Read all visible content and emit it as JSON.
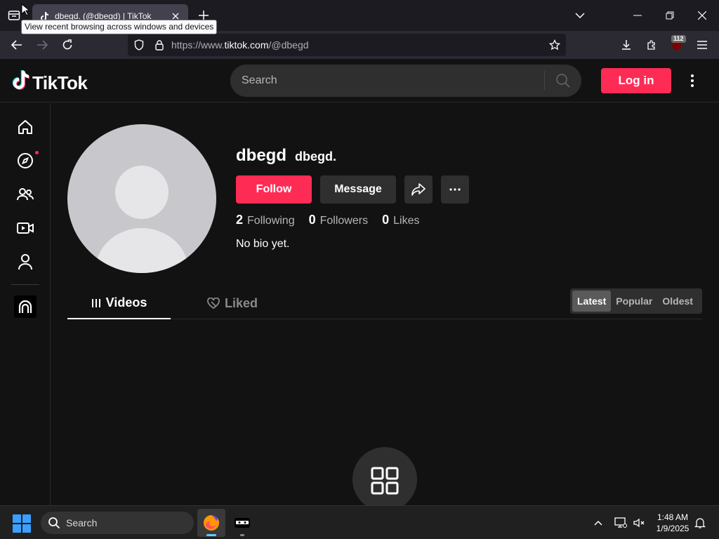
{
  "browser": {
    "tab_title": "dbegd. (@dbegd) | TikTok",
    "tooltip": "View recent browsing across windows and devices",
    "url_prefix": "https://www.",
    "url_host": "tiktok.com",
    "url_path": "/@dbegd",
    "extension_badge": "112"
  },
  "header": {
    "logo_text": "TikTok",
    "search_placeholder": "Search",
    "login_label": "Log in"
  },
  "sidebar": {
    "items": [
      {
        "icon": "home-icon"
      },
      {
        "icon": "explore-icon"
      },
      {
        "icon": "following-icon"
      },
      {
        "icon": "live-icon"
      },
      {
        "icon": "profile-icon"
      },
      {
        "icon": "app-icon"
      }
    ]
  },
  "profile": {
    "username": "dbegd",
    "nickname": "dbegd.",
    "follow_label": "Follow",
    "message_label": "Message",
    "stats": [
      {
        "count": "2",
        "label": "Following"
      },
      {
        "count": "0",
        "label": "Followers"
      },
      {
        "count": "0",
        "label": "Likes"
      }
    ],
    "bio": "No bio yet."
  },
  "content_tabs": {
    "videos": "Videos",
    "liked": "Liked",
    "sort_options": [
      "Latest",
      "Popular",
      "Oldest"
    ],
    "active_sort": "Latest"
  },
  "taskbar": {
    "search_placeholder": "Search",
    "time": "1:48 AM",
    "date": "1/9/2025"
  },
  "colors": {
    "accent": "#fe2c55",
    "background": "#121212",
    "surface": "#2f2f2f"
  }
}
